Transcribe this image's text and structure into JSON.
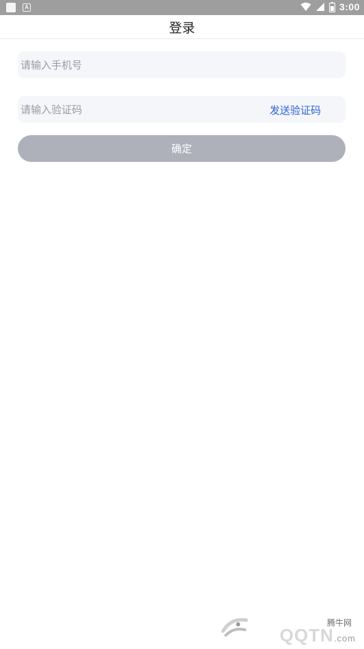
{
  "status_bar": {
    "time": "3:00",
    "left_icons": [
      "notification-square-icon",
      "app-a-icon"
    ],
    "right_icons": [
      "wifi-icon",
      "signal-icon",
      "battery-icon"
    ]
  },
  "header": {
    "title": "登录"
  },
  "form": {
    "phone_placeholder": "请输入手机号",
    "code_placeholder": "请输入验证码",
    "send_code_label": "发送验证码",
    "confirm_label": "确定"
  },
  "watermark": {
    "cn_text": "腾牛网",
    "en_text": "QQTN",
    "en_suffix": ".com"
  },
  "colors": {
    "status_bar": "#9e9e9e",
    "input_bg": "#f5f6fa",
    "link_blue": "#2c63d6",
    "button_disabled": "#aeb1b9"
  }
}
